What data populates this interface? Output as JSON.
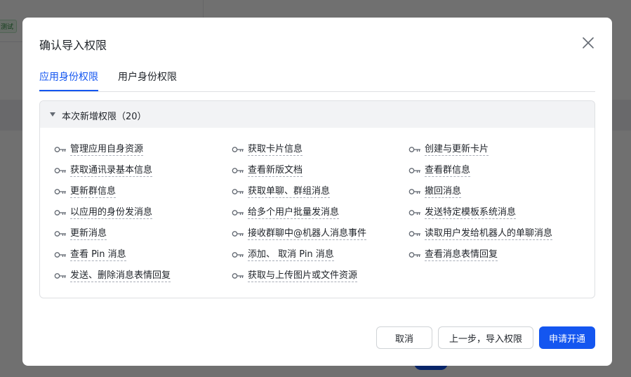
{
  "background": {
    "chip_label": "测试"
  },
  "modal": {
    "title": "确认导入权限",
    "tabs": [
      {
        "label": "应用身份权限",
        "active": true
      },
      {
        "label": "用户身份权限",
        "active": false
      }
    ],
    "section": {
      "title": "本次新增权限（20）",
      "expanded": true,
      "permissions": [
        "管理应用自身资源",
        "获取卡片信息",
        "创建与更新卡片",
        "获取通讯录基本信息",
        "查看新版文档",
        "查看群信息",
        "更新群信息",
        "获取单聊、群组消息",
        "撤回消息",
        "以应用的身份发消息",
        "给多个用户批量发消息",
        "发送特定模板系统消息",
        "更新消息",
        "接收群聊中@机器人消息事件",
        "读取用户发给机器人的单聊消息",
        "查看 Pin 消息",
        "添加、 取消 Pin 消息",
        "查看消息表情回复",
        "发送、删除消息表情回复",
        "获取与上传图片或文件资源"
      ]
    },
    "buttons": {
      "cancel": "取消",
      "back_import": "上一步，导入权限",
      "apply": "申请开通"
    }
  },
  "icons": {
    "close": "close-icon",
    "permission": "key-icon",
    "collapse": "caret-down-icon"
  },
  "colors": {
    "accent": "#1456f0",
    "text": "#1f2329",
    "muted": "#646a73"
  }
}
